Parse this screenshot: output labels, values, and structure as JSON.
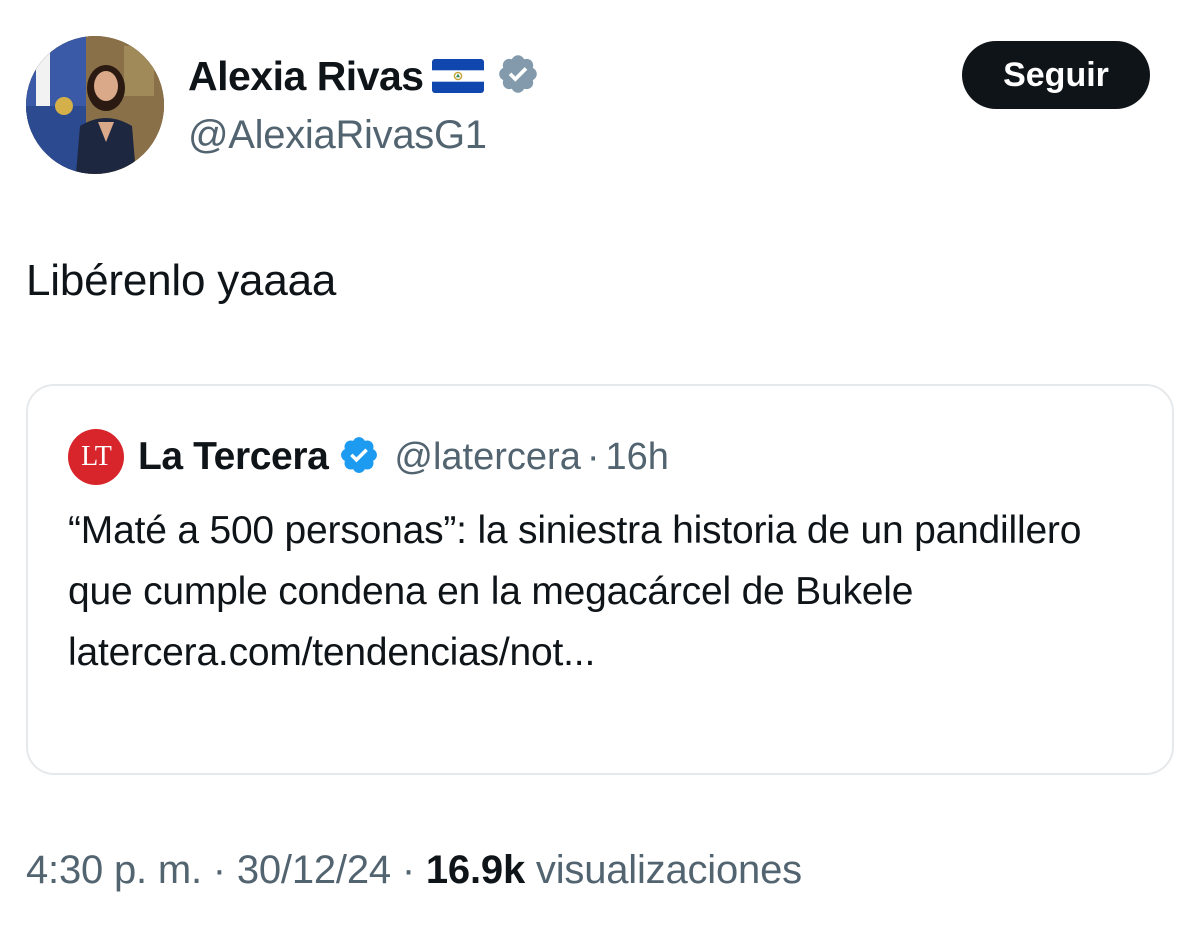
{
  "author": {
    "display_name": "Alexia Rivas",
    "flag": "El Salvador flag",
    "handle": "@AlexiaRivasG1",
    "verified_color": "#829aab"
  },
  "follow_button": {
    "label": "Seguir"
  },
  "tweet": {
    "text": "Libérenlo yaaaa"
  },
  "quoted": {
    "logo_text": "LT",
    "logo_color": "#d8252b",
    "name": "La Tercera",
    "verified_color": "#1d9bf0",
    "handle": "@latercera",
    "separator": "·",
    "time": "16h",
    "text": "“Maté a 500 personas”: la siniestra historia de un pandillero que cumple condena en la megacárcel de Bukele",
    "link": "latercera.com/tendencias/not..."
  },
  "meta": {
    "time": "4:30 p. m.",
    "sep1": " · ",
    "date": "30/12/24",
    "sep2": " · ",
    "views_count": "16.9k",
    "views_label": " visualizaciones"
  }
}
